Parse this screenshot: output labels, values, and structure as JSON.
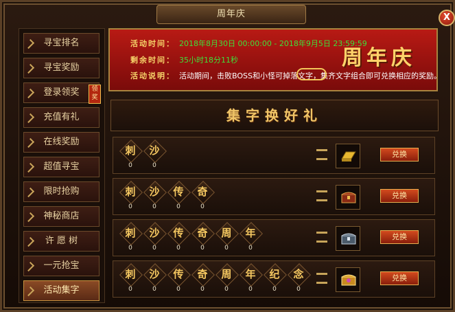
{
  "window": {
    "title": "周年庆",
    "close_label": "X"
  },
  "sidebar": {
    "items": [
      {
        "label": "寻宝排名",
        "active": false
      },
      {
        "label": "寻宝奖励",
        "active": false
      },
      {
        "label": "登录领奖",
        "active": false,
        "badge": "领奖"
      },
      {
        "label": "充值有礼",
        "active": false
      },
      {
        "label": "在线奖励",
        "active": false
      },
      {
        "label": "超值寻宝",
        "active": false
      },
      {
        "label": "限时抢购",
        "active": false
      },
      {
        "label": "神秘商店",
        "active": false
      },
      {
        "label": "许 愿 树",
        "active": false
      },
      {
        "label": "一元抢宝",
        "active": false
      },
      {
        "label": "活动集字",
        "active": true
      }
    ]
  },
  "banner": {
    "time_label": "活动时间：",
    "time_value": "2018年8月30日 00:00:00 - 2018年9月5日 23:59:59",
    "remain_label": "剩余时间：",
    "remain_value": "35小时18分11秒",
    "desc_label": "活动说明：",
    "desc_value": "活动期间，击败BOSS和小怪可掉落文字，集齐文字组合即可兑换相应的奖励。",
    "event_title": "周年庆"
  },
  "section": {
    "title": "集字换好礼"
  },
  "rows": [
    {
      "chars": [
        {
          "c": "刺",
          "n": "0"
        },
        {
          "c": "沙",
          "n": "0"
        }
      ],
      "reward_icon": "gold-bar-icon",
      "button": "兑换"
    },
    {
      "chars": [
        {
          "c": "刺",
          "n": "0"
        },
        {
          "c": "沙",
          "n": "0"
        },
        {
          "c": "传",
          "n": "0"
        },
        {
          "c": "奇",
          "n": "0"
        }
      ],
      "reward_icon": "red-treasure-chest-icon",
      "button": "兑换"
    },
    {
      "chars": [
        {
          "c": "刺",
          "n": "0"
        },
        {
          "c": "沙",
          "n": "0"
        },
        {
          "c": "传",
          "n": "0"
        },
        {
          "c": "奇",
          "n": "0"
        },
        {
          "c": "周",
          "n": "0"
        },
        {
          "c": "年",
          "n": "0"
        }
      ],
      "reward_icon": "silver-treasure-chest-icon",
      "button": "兑换"
    },
    {
      "chars": [
        {
          "c": "刺",
          "n": "0"
        },
        {
          "c": "沙",
          "n": "0"
        },
        {
          "c": "传",
          "n": "0"
        },
        {
          "c": "奇",
          "n": "0"
        },
        {
          "c": "周",
          "n": "0"
        },
        {
          "c": "年",
          "n": "0"
        },
        {
          "c": "纪",
          "n": "0"
        },
        {
          "c": "念",
          "n": "0"
        }
      ],
      "reward_icon": "golden-treasure-chest-icon",
      "button": "兑换"
    }
  ],
  "colors": {
    "gold": "#f5c861",
    "green": "#3ee03a",
    "banner_red": "#b81a14",
    "button_red": "#d24a1e"
  }
}
